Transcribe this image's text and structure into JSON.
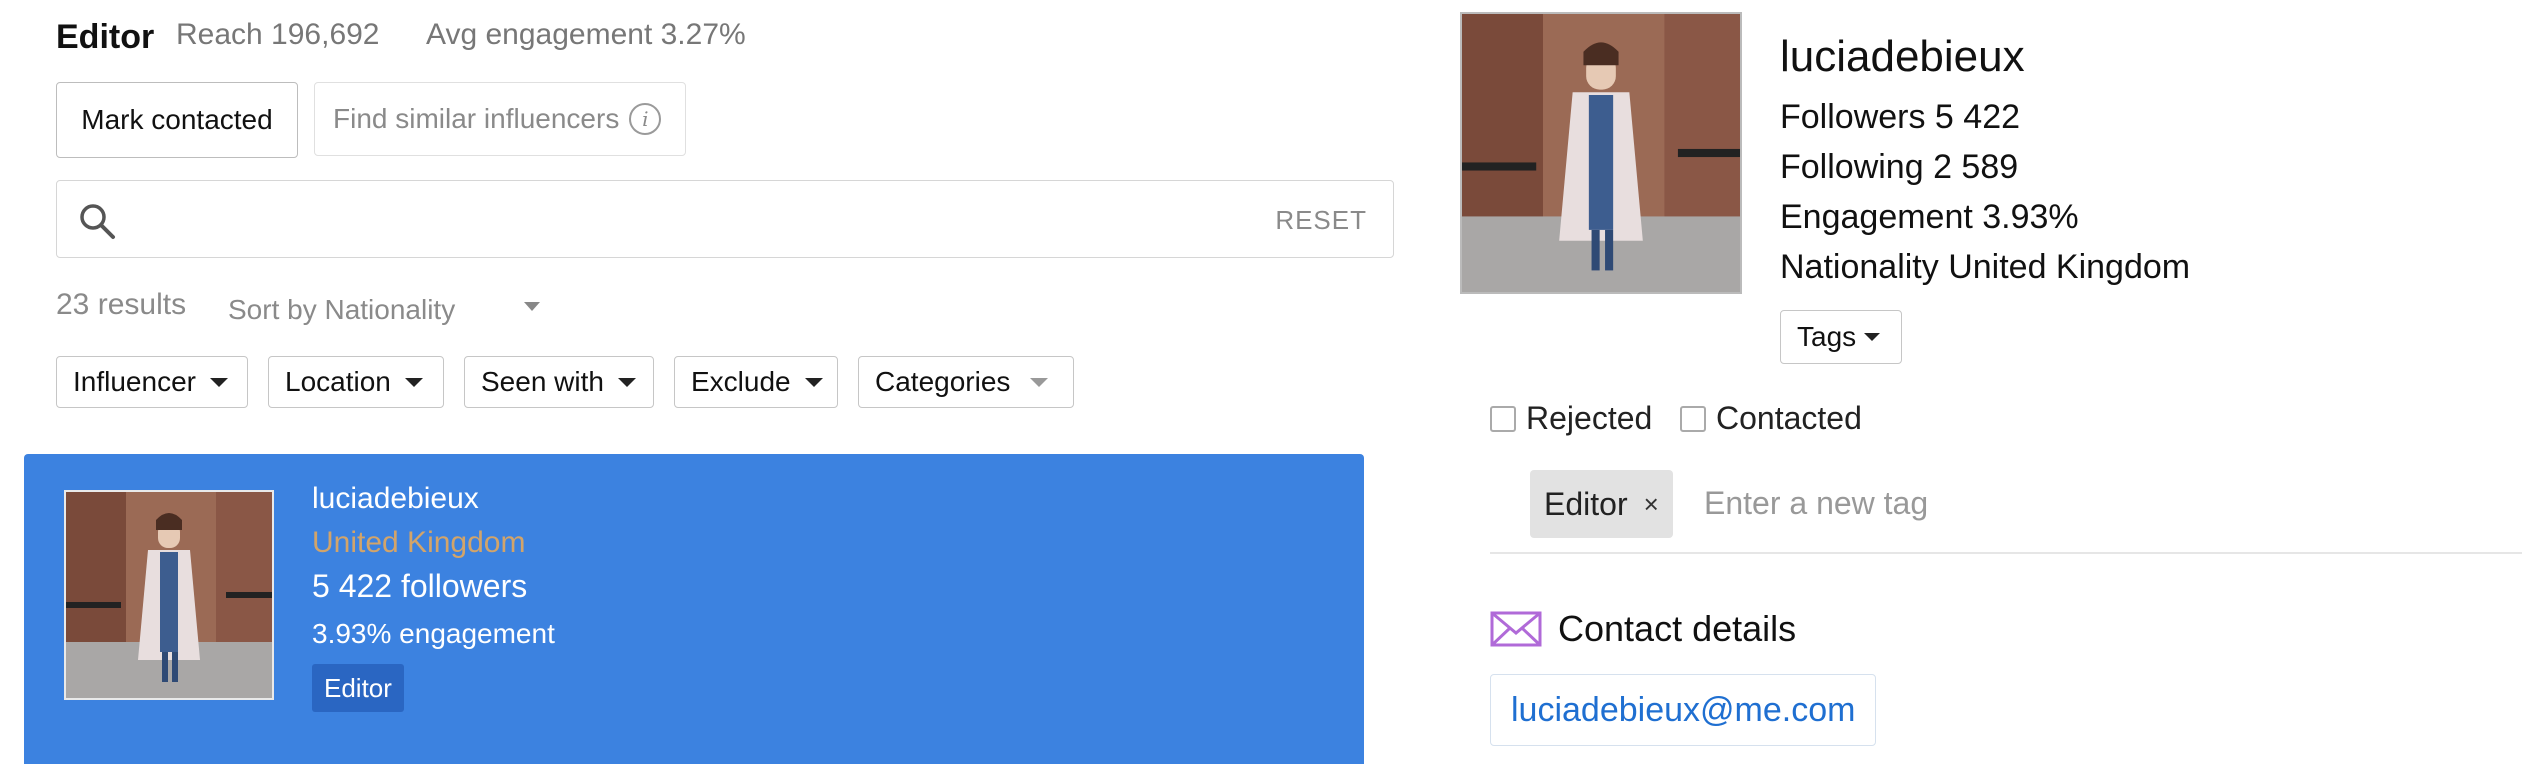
{
  "header": {
    "title": "Editor",
    "reach": "Reach 196,692",
    "avg_engagement": "Avg engagement 3.27%"
  },
  "actions": {
    "mark_contacted": "Mark contacted",
    "find_similar": "Find similar influencers",
    "info_glyph": "i"
  },
  "search": {
    "value": "",
    "placeholder": "",
    "reset_label": "RESET"
  },
  "results": {
    "count": "23 results",
    "sort_label": "Sort by Nationality"
  },
  "filters": [
    {
      "label": "Influencer"
    },
    {
      "label": "Location"
    },
    {
      "label": "Seen with"
    },
    {
      "label": "Exclude"
    },
    {
      "label": "Categories"
    }
  ],
  "result_card": {
    "username": "luciadebieux",
    "country": "United Kingdom",
    "followers": "5 422 followers",
    "engagement": "3.93% engagement",
    "tag": "Editor",
    "background_color": "#3c82e0"
  },
  "profile": {
    "username": "luciadebieux",
    "followers": "Followers 5 422",
    "following": "Following 2 589",
    "engagement": "Engagement 3.93%",
    "nationality": "Nationality United Kingdom",
    "tags_button": "Tags",
    "rejected_label": "Rejected",
    "contacted_label": "Contacted",
    "tag_chip": "Editor",
    "tag_chip_close": "×",
    "tag_input_placeholder": "Enter a new tag",
    "contact_title": "Contact details",
    "email": "luciadebieux@me.com"
  },
  "icons": {
    "search": "search-icon",
    "info": "info-icon",
    "mail": "mail-icon",
    "caret": "caret-down-icon",
    "close": "close-icon"
  },
  "colors": {
    "accent_blue": "#3c82e0",
    "tag_blue": "#2a66c2",
    "email_link": "#1f6fd1",
    "mail_icon": "#b06ad8",
    "country_text": "#d2a46a"
  }
}
